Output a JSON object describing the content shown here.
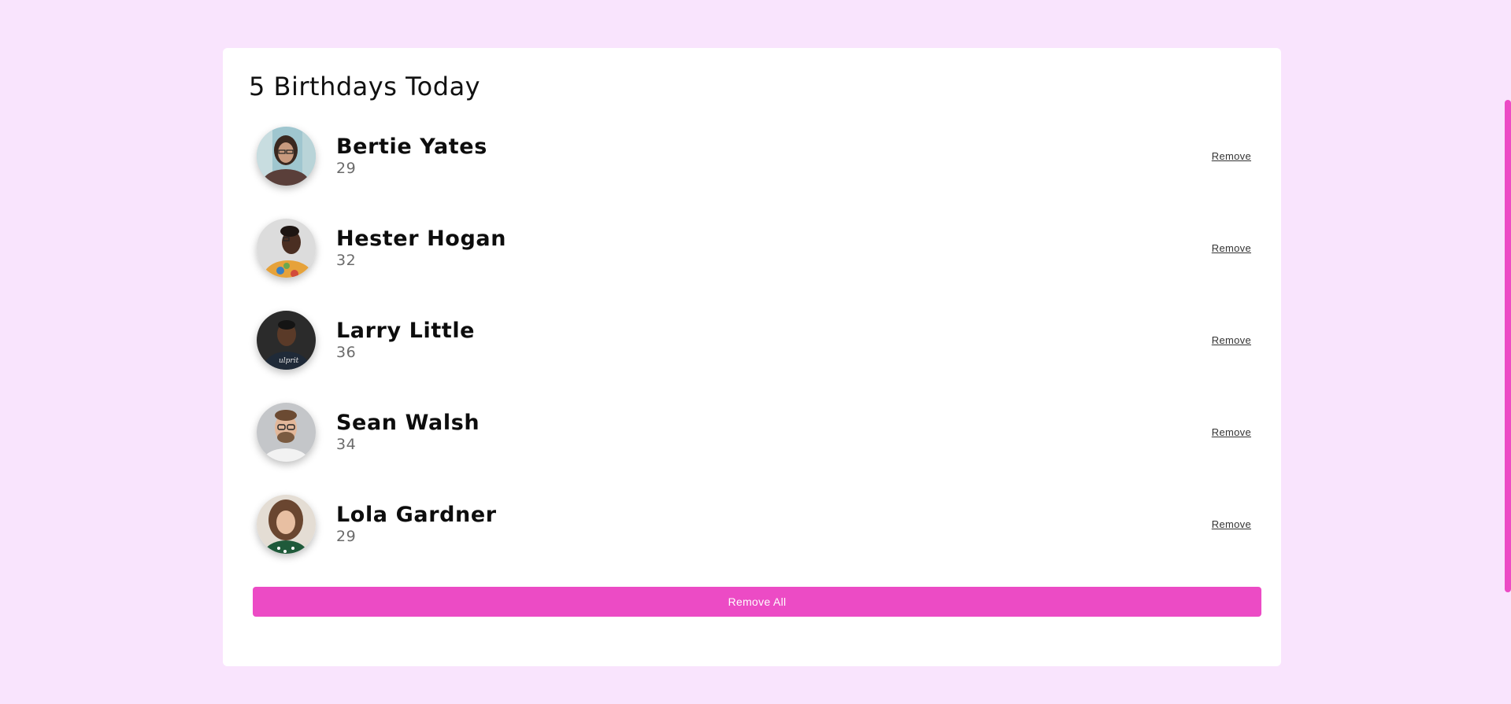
{
  "header": {
    "title": "5 Birthdays Today"
  },
  "people": [
    {
      "name": "Bertie Yates",
      "age": "29",
      "avatar": "woman-glasses-photo",
      "remove_label": "Remove"
    },
    {
      "name": "Hester Hogan",
      "age": "32",
      "avatar": "woman-floral-photo",
      "remove_label": "Remove"
    },
    {
      "name": "Larry Little",
      "age": "36",
      "avatar": "man-dark-shirt-photo",
      "remove_label": "Remove"
    },
    {
      "name": "Sean Walsh",
      "age": "34",
      "avatar": "man-glasses-beard-photo",
      "remove_label": "Remove"
    },
    {
      "name": "Lola Gardner",
      "age": "29",
      "avatar": "woman-curly-hair-photo",
      "remove_label": "Remove"
    }
  ],
  "actions": {
    "remove_all_label": "Remove All"
  },
  "colors": {
    "background": "#f9e4fd",
    "accent": "#ec4bc5",
    "card": "#ffffff"
  }
}
